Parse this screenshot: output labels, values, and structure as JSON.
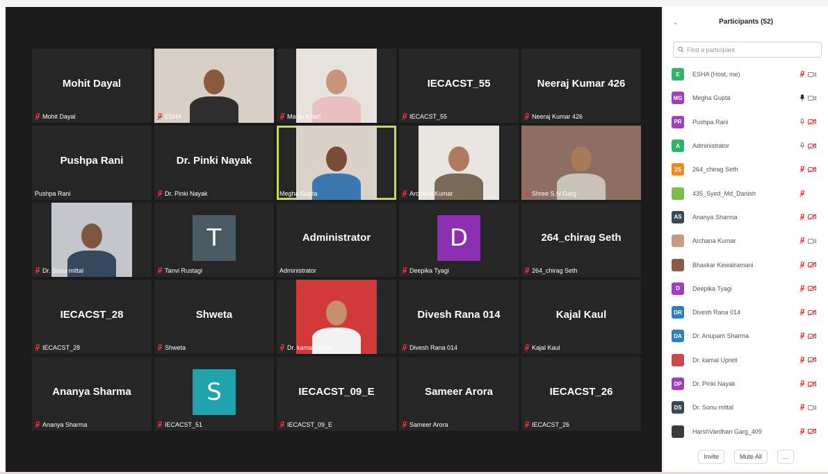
{
  "participants_panel": {
    "title": "Participants (52)",
    "search_placeholder": "Find a participant",
    "invite_label": "Invite",
    "mute_all_label": "Mute All",
    "more_label": "...",
    "list": [
      {
        "initials": "E",
        "name": "ESHA (Host, me)",
        "color": "#2fb36a",
        "mic": "muted",
        "video": "on"
      },
      {
        "initials": "MG",
        "name": "Megha Gupta",
        "color": "#a13ec0",
        "mic": "active",
        "video": "on"
      },
      {
        "initials": "PR",
        "name": "Pushpa Rani",
        "color": "#a13ec0",
        "mic": "unmuted",
        "video": "off"
      },
      {
        "initials": "A",
        "name": "Administrator",
        "color": "#2fb36a",
        "mic": "unmuted",
        "video": "off"
      },
      {
        "initials": "2S",
        "name": "264_chirag Seth",
        "color": "#f08c1c",
        "mic": "muted",
        "video": "off"
      },
      {
        "initials": "",
        "name": "435_Syed_Md_Danish",
        "color": "#7bbf4a",
        "mic": "muted",
        "video": "none"
      },
      {
        "initials": "AS",
        "name": "Ananya Sharma",
        "color": "#3a4755",
        "mic": "muted",
        "video": "off"
      },
      {
        "initials": "",
        "name": "Archana Kumar",
        "color": "#c99a83",
        "mic": "muted",
        "video": "on"
      },
      {
        "initials": "",
        "name": "Bhaskar Kewalramani",
        "color": "#8a5a48",
        "mic": "muted",
        "video": "off"
      },
      {
        "initials": "D",
        "name": "Deepika Tyagi",
        "color": "#a13ec0",
        "mic": "muted",
        "video": "off"
      },
      {
        "initials": "DR",
        "name": "Divesh Rana 014",
        "color": "#2d7fc1",
        "mic": "muted",
        "video": "off"
      },
      {
        "initials": "DA",
        "name": "Dr. Anupam Sharma",
        "color": "#2d7fc1",
        "mic": "muted",
        "video": "off"
      },
      {
        "initials": "",
        "name": "Dr. kamal Upreti",
        "color": "#c94a4a",
        "mic": "muted",
        "video": "off"
      },
      {
        "initials": "DP",
        "name": "Dr. Pinki Nayak",
        "color": "#a13ec0",
        "mic": "muted",
        "video": "off"
      },
      {
        "initials": "DS",
        "name": "Dr. Sonu mittal",
        "color": "#3a4755",
        "mic": "muted",
        "video": "on"
      },
      {
        "initials": "",
        "name": "HarshVardhan Garg_409",
        "color": "#3a3a3a",
        "mic": "muted",
        "video": "off"
      }
    ]
  },
  "gallery": {
    "tiles": [
      {
        "kind": "name",
        "display": "Mohit Dayal",
        "label": "Mohit Dayal",
        "muted": true
      },
      {
        "kind": "video",
        "display": "",
        "label": "ESHA",
        "muted": true,
        "bg": "#d8cfc7",
        "skin": "#8a5a3e",
        "shirt": "#2e2e2e",
        "wide": true
      },
      {
        "kind": "video",
        "display": "",
        "label": "Manju Khari",
        "muted": true,
        "bg": "#e7e2dc",
        "skin": "#c9957a",
        "shirt": "#e8c0c0"
      },
      {
        "kind": "name",
        "display": "IECACST_55",
        "label": "IECACST_55",
        "muted": true
      },
      {
        "kind": "name",
        "display": "Neeraj Kumar 426",
        "label": "Neeraj Kumar 426",
        "muted": true
      },
      {
        "kind": "name",
        "display": "Pushpa Rani",
        "label": "Pushpa Rani",
        "muted": false
      },
      {
        "kind": "name",
        "display": "Dr. Pinki Nayak",
        "label": "Dr. Pinki Nayak",
        "muted": true
      },
      {
        "kind": "video",
        "display": "",
        "label": "Megha Gupta",
        "muted": false,
        "bg": "#d9d2c8",
        "skin": "#7a4e35",
        "shirt": "#3b78b0",
        "active": true
      },
      {
        "kind": "video",
        "display": "",
        "label": "Archana Kumar",
        "muted": true,
        "bg": "#e9e6e1",
        "skin": "#b07a5e",
        "shirt": "#7a6a58"
      },
      {
        "kind": "video",
        "display": "",
        "label": "Shree S.N Garg",
        "muted": true,
        "bg": "#8c6f60",
        "skin": "#a77a5a",
        "shirt": "#c8c2b8",
        "wide": true
      },
      {
        "kind": "video",
        "display": "",
        "label": "Dr. Sonu mittal",
        "muted": true,
        "bg": "#c3c7cb",
        "skin": "#7e5740",
        "shirt": "#34495e"
      },
      {
        "kind": "letter",
        "display": "T",
        "label": "Tanvi Rustagi",
        "muted": true,
        "color": "#4b5b66"
      },
      {
        "kind": "name",
        "display": "Administrator",
        "label": "Administrator",
        "muted": false
      },
      {
        "kind": "letter",
        "display": "D",
        "label": "Deepika Tyagi",
        "muted": true,
        "color": "#8a2fb1"
      },
      {
        "kind": "name",
        "display": "264_chirag Seth",
        "label": "264_chirag Seth",
        "muted": true
      },
      {
        "kind": "name",
        "display": "IECACST_28",
        "label": "IECACST_28",
        "muted": true
      },
      {
        "kind": "name",
        "display": "Shweta",
        "label": "Shweta",
        "muted": true
      },
      {
        "kind": "video",
        "display": "",
        "label": "Dr. kamal Upreti",
        "muted": true,
        "bg": "#d23a3a",
        "skin": "#c7906c",
        "shirt": "#f2f2f2"
      },
      {
        "kind": "name",
        "display": "Divesh Rana 014",
        "label": "Divesh Rana 014",
        "muted": true
      },
      {
        "kind": "name",
        "display": "Kajal Kaul",
        "label": "Kajal Kaul",
        "muted": true
      },
      {
        "kind": "name",
        "display": "Ananya Sharma",
        "label": "Ananya Sharma",
        "muted": true
      },
      {
        "kind": "letter",
        "display": "S",
        "label": "IECACST_51",
        "muted": true,
        "color": "#1fa3ad"
      },
      {
        "kind": "name",
        "display": "IECACST_09_E",
        "label": "IECACST_09_E",
        "muted": true
      },
      {
        "kind": "name",
        "display": "Sameer Arora",
        "label": "Sameer Arora",
        "muted": true
      },
      {
        "kind": "name",
        "display": "IECACST_26",
        "label": "IECACST_26",
        "muted": true
      }
    ]
  }
}
